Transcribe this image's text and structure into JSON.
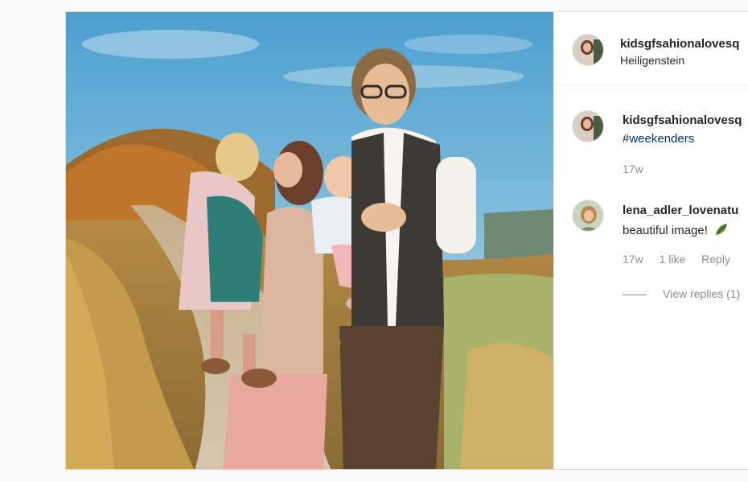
{
  "post": {
    "author": {
      "username": "kidsgfsahionalovesq",
      "location": "Heiligenstein",
      "avatar_icon": "profile-photo-icon"
    },
    "photo": {
      "icon": "family-photo"
    },
    "comments": [
      {
        "username": "kidsgfsahionalovesq",
        "text": "#weekenders",
        "age": "17w"
      },
      {
        "username": "lena_adler_lovenatu",
        "text": "beautiful image!",
        "emoji_icon": "leaf-icon",
        "age": "17w",
        "likes": "1 like",
        "reply_label": "Reply",
        "view_replies": "View replies (1)"
      }
    ]
  },
  "colors": {
    "page_background": "#fafafa",
    "hashtag": "#00376b",
    "muted_text": "#8e8e8e",
    "border": "#dbdbdb"
  }
}
